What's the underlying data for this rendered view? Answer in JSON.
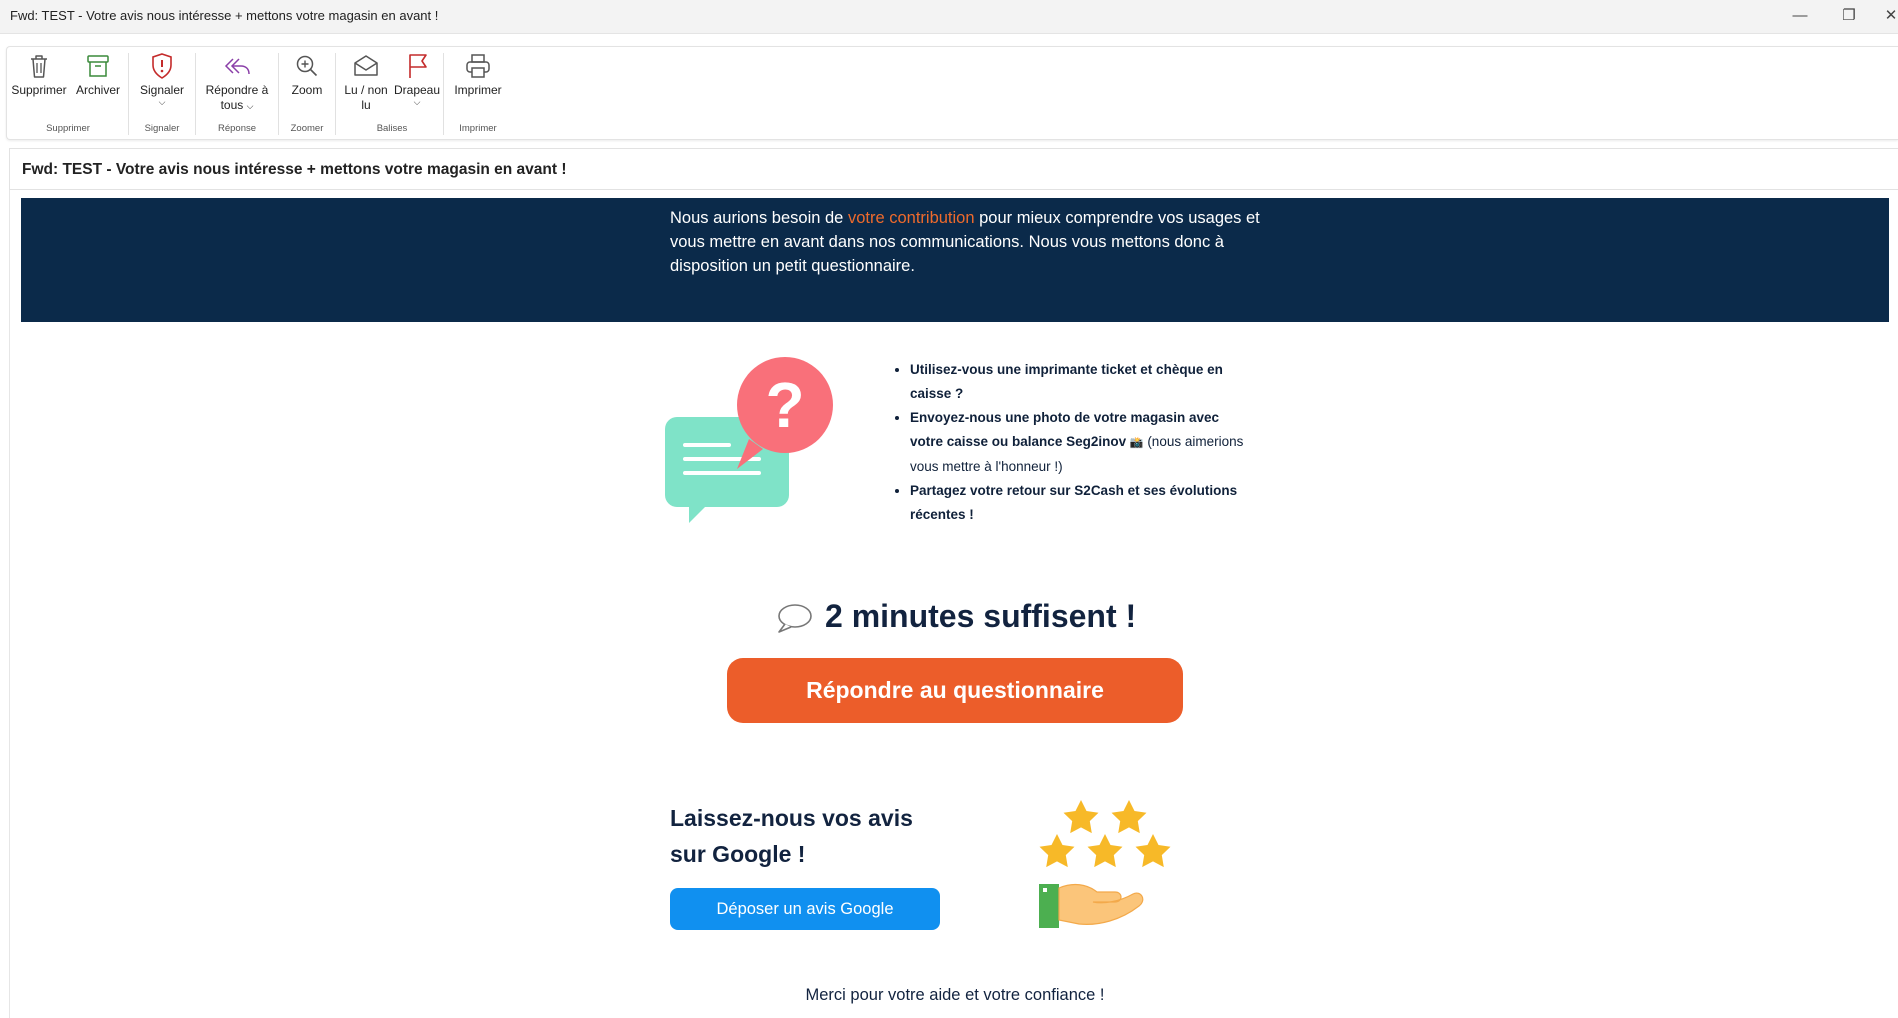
{
  "window": {
    "title": "Fwd: TEST - Votre avis nous intéresse + mettons votre magasin en avant !",
    "minimize_glyph": "—",
    "restore_glyph": "❐",
    "close_glyph": "✕"
  },
  "ribbon": {
    "groups": [
      {
        "label": "Supprimer",
        "buttons": [
          {
            "label": "Supprimer",
            "icon": "trash-icon"
          },
          {
            "label": "Archiver",
            "icon": "archive-icon"
          }
        ]
      },
      {
        "label": "Signaler",
        "buttons": [
          {
            "label": "Signaler",
            "icon": "shield-alert-icon"
          }
        ]
      },
      {
        "label": "Réponse",
        "buttons": [
          {
            "label": "Répondre à tous",
            "line1": "Répondre à",
            "line2": "tous",
            "icon": "reply-all-icon"
          }
        ]
      },
      {
        "label": "Zoomer",
        "buttons": [
          {
            "label": "Zoom",
            "icon": "zoom-in-icon"
          }
        ]
      },
      {
        "label": "Balises",
        "buttons": [
          {
            "label": "Lu / non lu",
            "line1": "Lu / non",
            "line2": "lu",
            "icon": "envelope-open-icon"
          },
          {
            "label": "Drapeau",
            "icon": "flag-icon"
          }
        ]
      },
      {
        "label": "Imprimer",
        "buttons": [
          {
            "label": "Imprimer",
            "icon": "printer-icon"
          }
        ]
      }
    ],
    "chevron": "⌵"
  },
  "message": {
    "subject": "Fwd: TEST - Votre avis nous intéresse +  mettons votre magasin en avant !",
    "intro": {
      "before": "Nous aurions besoin de ",
      "highlight": "votre contribution",
      "after": " pour mieux comprendre vos usages et vous mettre en avant dans nos communications. Nous vous mettons donc à disposition un petit questionnaire."
    },
    "bullets": [
      {
        "bold": "Utilisez-vous une imprimante ticket et chèque en caisse ?",
        "normal": ""
      },
      {
        "bold": "Envoyez-nous une photo de votre magasin avec votre caisse ou balance Seg2inov",
        "emoji": "📸",
        "normal": " (nous aimerions vous mettre à l'honneur !)"
      },
      {
        "bold": "Partagez votre retour sur S2Cash et ses évolutions récentes !",
        "normal": ""
      }
    ],
    "minutes_text": "2 minutes suffisent !",
    "cta_label": "Répondre au questionnaire",
    "google_title_line1": "Laissez-nous vos avis",
    "google_title_line2": "sur Google !",
    "google_button": "Déposer un avis Google",
    "thanks": "Merci pour votre aide et votre confiance !"
  },
  "colors": {
    "navy": "#0b2a4a",
    "accent_orange": "#ec5d2a",
    "google_blue": "#1090f0",
    "heading_text": "#12233f"
  }
}
